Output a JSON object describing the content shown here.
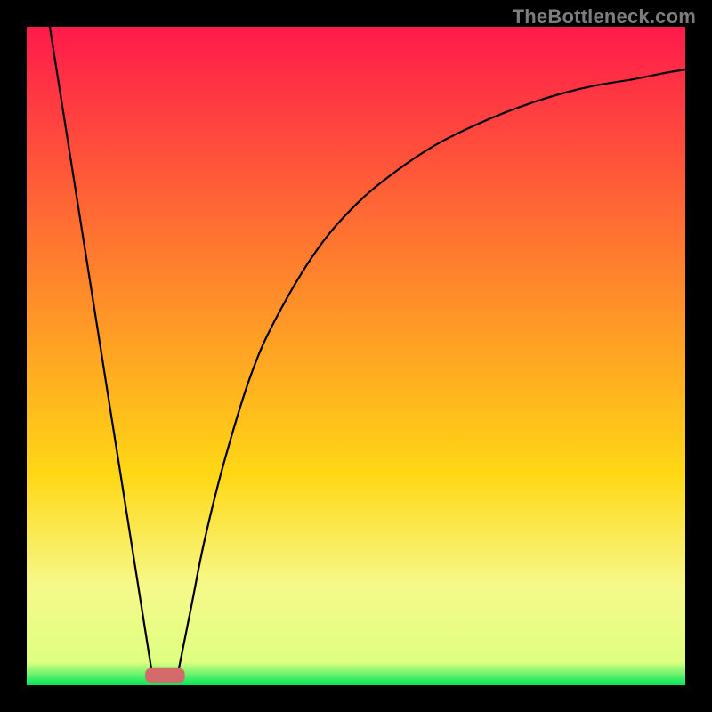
{
  "watermark": "TheBottleneck.com",
  "chart_data": {
    "type": "line",
    "title": "",
    "xlabel": "",
    "ylabel": "",
    "xlim": [
      0,
      100
    ],
    "ylim": [
      0,
      100
    ],
    "background": {
      "kind": "vertical-gradient",
      "stops": [
        {
          "pos": 0.0,
          "color": "#ff1a4b"
        },
        {
          "pos": 0.4,
          "color": "#ff8a2a"
        },
        {
          "pos": 0.68,
          "color": "#ffd815"
        },
        {
          "pos": 0.85,
          "color": "#f6f98a"
        },
        {
          "pos": 0.965,
          "color": "#dfff80"
        },
        {
          "pos": 1.0,
          "color": "#00e65c"
        }
      ]
    },
    "series": [
      {
        "name": "line-left",
        "note": "Straight line dropping from top-left to the valley floor",
        "x": [
          3.5,
          19.0
        ],
        "y": [
          100.0,
          2.0
        ]
      },
      {
        "name": "line-right",
        "note": "Curve rising from the valley floor toward the top-right, asymptotic around y≈94",
        "x": [
          23.0,
          25,
          27,
          30,
          34,
          38,
          44,
          50,
          56,
          62,
          68,
          74,
          80,
          86,
          92,
          97,
          100
        ],
        "y": [
          2.0,
          12,
          22,
          34,
          47,
          56,
          66,
          73,
          78,
          82,
          85,
          87.5,
          89.5,
          91,
          92,
          93,
          93.5
        ]
      }
    ],
    "marker": {
      "name": "valley-marker",
      "shape": "rounded-rect",
      "color": "#d46a6a",
      "x_center": 21.0,
      "y_center": 1.5,
      "width": 6.0,
      "height": 2.2
    },
    "frame": {
      "color": "#000000",
      "thickness_px": 30
    }
  }
}
